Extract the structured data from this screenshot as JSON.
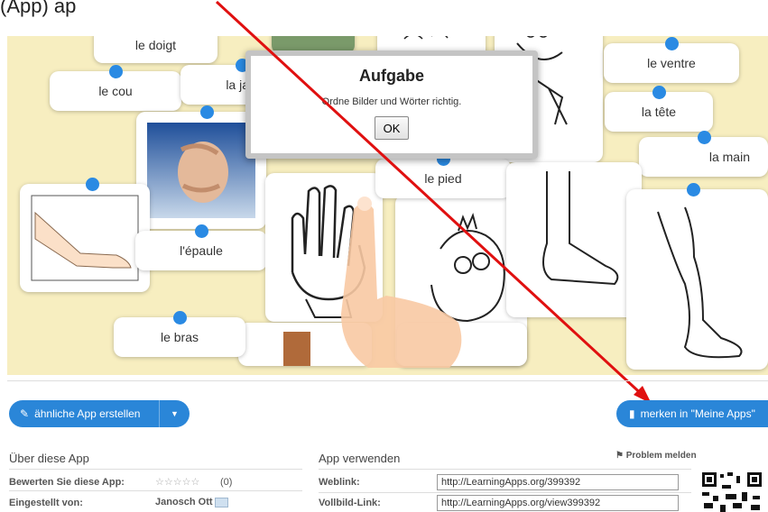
{
  "top_text": "(App) ap",
  "board": {
    "word_cards": {
      "doigt": "le doigt",
      "cou": "le cou",
      "jambe": "la ja",
      "ventre": "le ventre",
      "tete": "la tête",
      "main": "la main",
      "pied": "le pied",
      "epaule": "l'épaule",
      "bras": "le bras"
    }
  },
  "modal": {
    "title": "Aufgabe",
    "text": "Ordne Bilder und Wörter richtig.",
    "ok_label": "OK"
  },
  "actions": {
    "create_label": "ähnliche App erstellen",
    "save_label": "merken in \"Meine Apps\""
  },
  "about": {
    "title": "Über diese App",
    "rate_label": "Bewerten Sie diese App:",
    "rating_stars": "☆☆☆☆☆",
    "rating_count": "(0)",
    "author_label": "Eingestellt von:",
    "author": "Janosch Ott"
  },
  "use": {
    "title": "App verwenden",
    "report_label": "Problem melden",
    "weblink_label": "Weblink:",
    "weblink_value": "http://LearningApps.org/399392",
    "fullscreen_label": "Vollbild-Link:",
    "fullscreen_value": "http://LearningApps.org/view399392"
  },
  "colors": {
    "accent": "#2a86d8",
    "board": "#f7eec0",
    "arrow": "#e01010"
  }
}
